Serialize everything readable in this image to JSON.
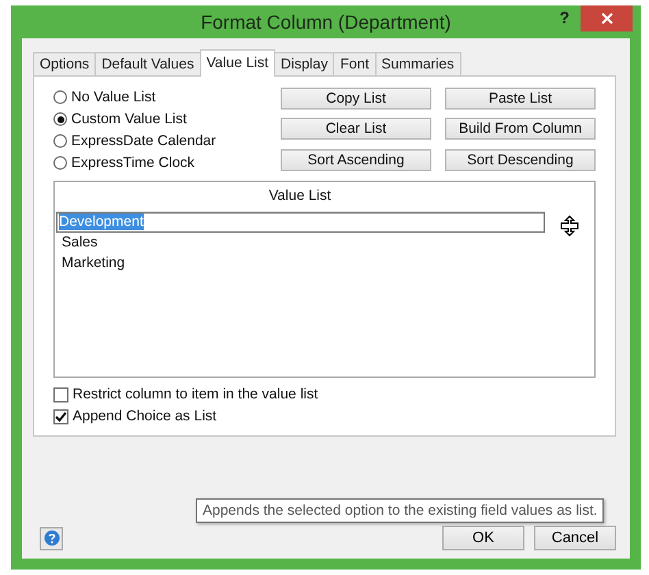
{
  "window": {
    "title": "Format Column (Department)",
    "help": "?"
  },
  "tabs": [
    {
      "label": "Options",
      "selected": false
    },
    {
      "label": "Default Values",
      "selected": false
    },
    {
      "label": "Value List",
      "selected": true
    },
    {
      "label": "Display",
      "selected": false
    },
    {
      "label": "Font",
      "selected": false
    },
    {
      "label": "Summaries",
      "selected": false
    }
  ],
  "list_types": [
    {
      "label": "No Value List",
      "selected": false
    },
    {
      "label": "Custom Value List",
      "selected": true
    },
    {
      "label": "ExpressDate Calendar",
      "selected": false
    },
    {
      "label": "ExpressTime Clock",
      "selected": false
    }
  ],
  "list_buttons": [
    "Copy List",
    "Paste List",
    "Clear List",
    "Build From Column",
    "Sort Ascending",
    "Sort Descending"
  ],
  "value_list": {
    "header": "Value List",
    "rows": [
      {
        "text": "Development",
        "editing": true
      },
      {
        "text": "Sales",
        "editing": false
      },
      {
        "text": "Marketing",
        "editing": false
      }
    ]
  },
  "options": [
    {
      "label": "Restrict column to item in the value list",
      "checked": false
    },
    {
      "label": "Append Choice as List",
      "checked": true
    }
  ],
  "tooltip": "Appends the selected option to the existing field values as list.",
  "footer_buttons": [
    "OK",
    "Cancel"
  ]
}
